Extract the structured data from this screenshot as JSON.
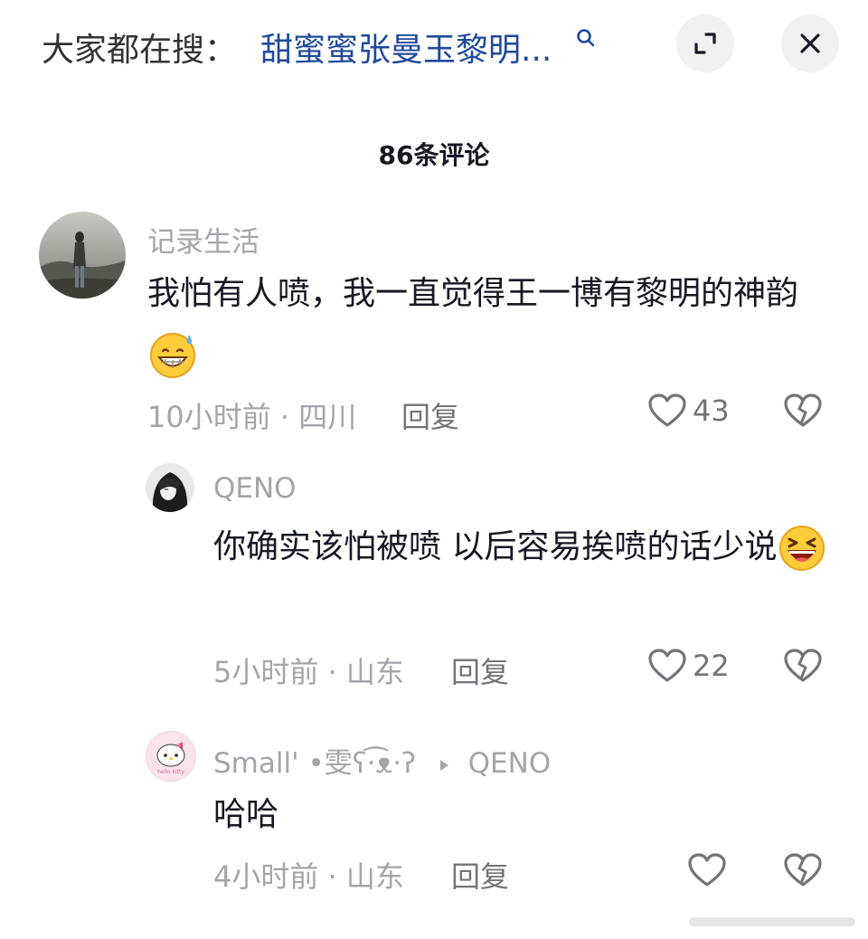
{
  "header": {
    "search_prefix": "大家都在搜：",
    "search_query": "甜蜜蜜张曼玉黎明...",
    "expand_icon": "expand-icon",
    "close_icon": "close-icon"
  },
  "comments_title": "86条评论",
  "comments": [
    {
      "username": "记录生活",
      "text": "我怕有人喷，我一直觉得王一博有黎明的神韵",
      "emoji": "grinning-sweat-emoji",
      "time": "10小时前",
      "location": "四川",
      "reply_label": "回复",
      "likes": "43"
    },
    {
      "username": "QENO",
      "text": "你确实该怕被喷 以后容易挨喷的话少说",
      "emoji": "laughing-emoji",
      "time": "5小时前",
      "location": "山东",
      "reply_label": "回复",
      "likes": "22"
    },
    {
      "username": "Small' •雯ʕ·͡ᴥ·ʔ",
      "reply_to": "QENO",
      "text": "哈哈",
      "time": "4小时前",
      "location": "山东",
      "reply_label": "回复",
      "likes": ""
    }
  ],
  "colors": {
    "link": "#1f4a9c",
    "muted": "#a4a5aa",
    "text": "#161823"
  }
}
